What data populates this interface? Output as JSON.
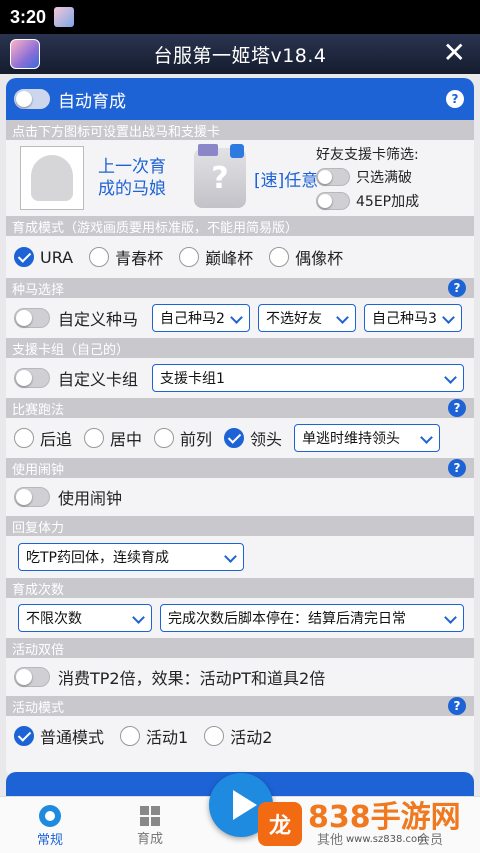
{
  "status": {
    "time": "3:20"
  },
  "window": {
    "title": "台服第一姬塔v18.4",
    "close": "✕"
  },
  "auto_train": {
    "label": "自动育成",
    "help": "?"
  },
  "horse": {
    "header": "点击下方图标可设置出战马和支援卡",
    "last_horse": "上一次育成的马娘",
    "support": "[速]任意",
    "friend_filter": "好友支援卡筛选:",
    "only_full": "只选满破",
    "ep45": "45EP加成",
    "q_mark": "?"
  },
  "mode": {
    "header": "育成模式（游戏画质要用标准版，不能用简易版）",
    "options": [
      "URA",
      "青春杯",
      "巅峰杯",
      "偶像杯"
    ],
    "selected": "URA"
  },
  "breeding": {
    "header": "种马选择",
    "custom": "自定义种马",
    "sel1": "自己种马2",
    "sel2": "不选好友",
    "sel3": "自己种马3"
  },
  "support_group": {
    "header": "支援卡组（自己的）",
    "custom": "自定义卡组",
    "select": "支援卡组1"
  },
  "race_style": {
    "header": "比赛跑法",
    "options": [
      "后追",
      "居中",
      "前列",
      "领头"
    ],
    "selected": "领头",
    "select": "单逃时维持领头"
  },
  "alarm": {
    "header": "使用闹钟",
    "label": "使用闹钟"
  },
  "stamina": {
    "header": "回复体力",
    "select": "吃TP药回体，连续育成"
  },
  "train_count": {
    "header": "育成次数",
    "sel1": "不限次数",
    "sel2": "完成次数后脚本停在：结算后清完日常"
  },
  "event_double": {
    "header": "活动双倍",
    "label": "消费TP2倍，效果：活动PT和道具2倍"
  },
  "event_mode": {
    "header": "活动模式",
    "options": [
      "普通模式",
      "活动1",
      "活动2"
    ],
    "selected": "普通模式"
  },
  "bottom_nav": [
    "常规",
    "育成",
    "其他",
    "会员"
  ],
  "watermark": {
    "brand": "838手游网",
    "url": "www.sz838.com"
  },
  "colors": {
    "accent": "#1e63d6",
    "section_gray": "#c9c9cd"
  }
}
